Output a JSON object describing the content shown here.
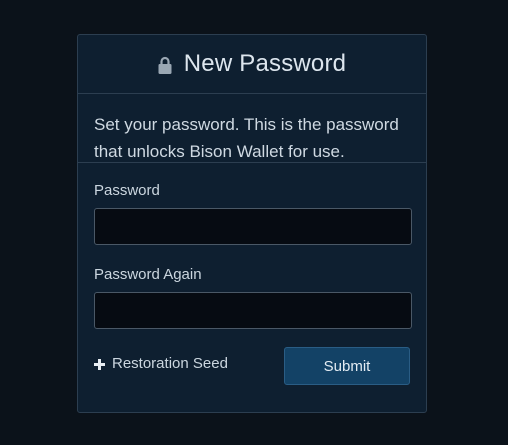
{
  "dialog": {
    "title": "New Password",
    "title_icon": "lock-icon",
    "intro_text": "Set your password. This is the password that unlocks Bison Wallet for use."
  },
  "form": {
    "password_label": "Password",
    "password_value": "",
    "password_again_label": "Password Again",
    "password_again_value": "",
    "seed_toggle_label": "Restoration Seed",
    "seed_toggle_icon": "plus-icon",
    "submit_label": "Submit"
  },
  "colors": {
    "background": "#0b121a",
    "card": "#0e1f30",
    "accent_button": "#134266"
  }
}
